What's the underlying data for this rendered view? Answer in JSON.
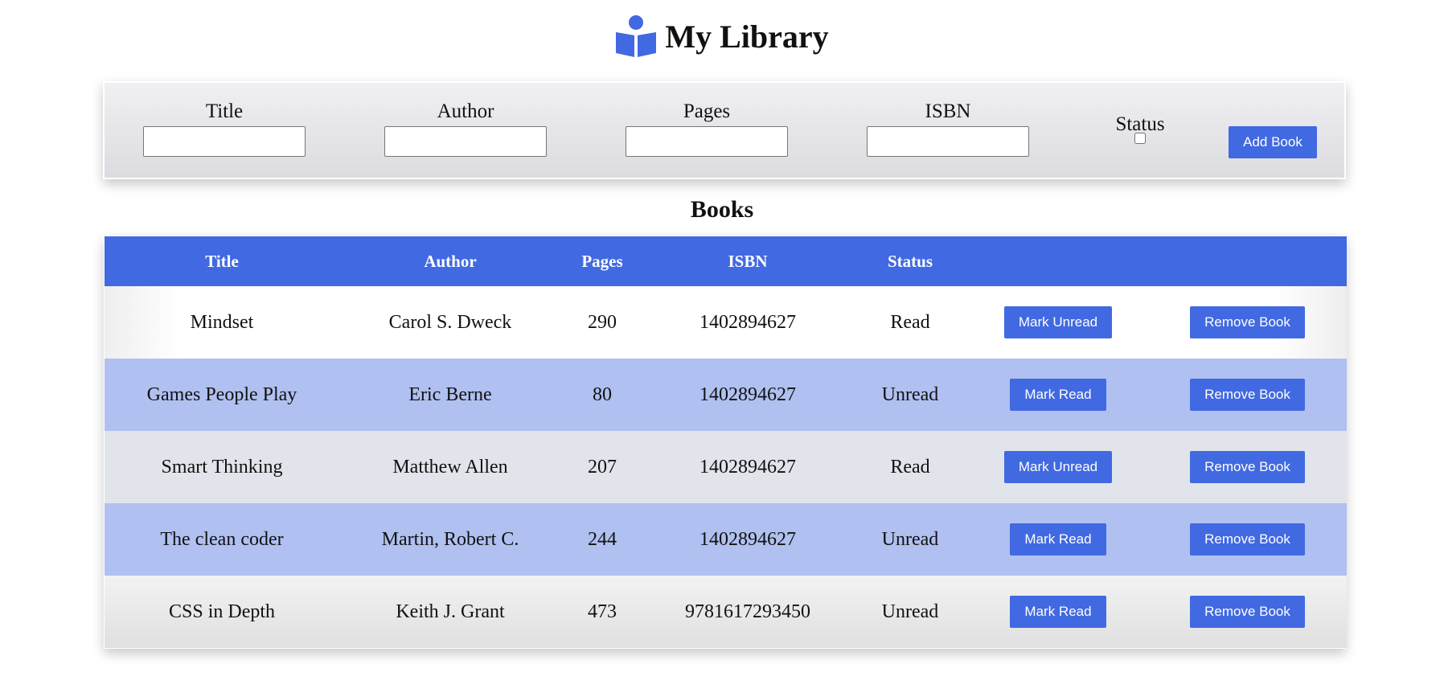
{
  "app": {
    "title": "My Library",
    "logo_icon": "book-reader-icon",
    "accent_color": "#4169e1"
  },
  "form": {
    "fields": [
      {
        "label": "Title",
        "value": ""
      },
      {
        "label": "Author",
        "value": ""
      },
      {
        "label": "Pages",
        "value": ""
      },
      {
        "label": "ISBN",
        "value": ""
      }
    ],
    "status_label": "Status",
    "status_checked": false,
    "add_button": "Add Book"
  },
  "books": {
    "title": "Books",
    "columns": [
      "Title",
      "Author",
      "Pages",
      "ISBN",
      "Status",
      "",
      ""
    ],
    "rows": [
      {
        "title": "Mindset",
        "author": "Carol S. Dweck",
        "pages": "290",
        "isbn": "1402894627",
        "status": "Read",
        "toggle": "Mark Unread",
        "remove": "Remove Book"
      },
      {
        "title": "Games People Play",
        "author": "Eric Berne",
        "pages": "80",
        "isbn": "1402894627",
        "status": "Unread",
        "toggle": "Mark Read",
        "remove": "Remove Book"
      },
      {
        "title": "Smart Thinking",
        "author": "Matthew Allen",
        "pages": "207",
        "isbn": "1402894627",
        "status": "Read",
        "toggle": "Mark Unread",
        "remove": "Remove Book"
      },
      {
        "title": "The clean coder",
        "author": "Martin, Robert C.",
        "pages": "244",
        "isbn": "1402894627",
        "status": "Unread",
        "toggle": "Mark Read",
        "remove": "Remove Book"
      },
      {
        "title": "CSS in Depth",
        "author": "Keith J. Grant",
        "pages": "473",
        "isbn": "9781617293450",
        "status": "Unread",
        "toggle": "Mark Read",
        "remove": "Remove Book"
      }
    ]
  }
}
